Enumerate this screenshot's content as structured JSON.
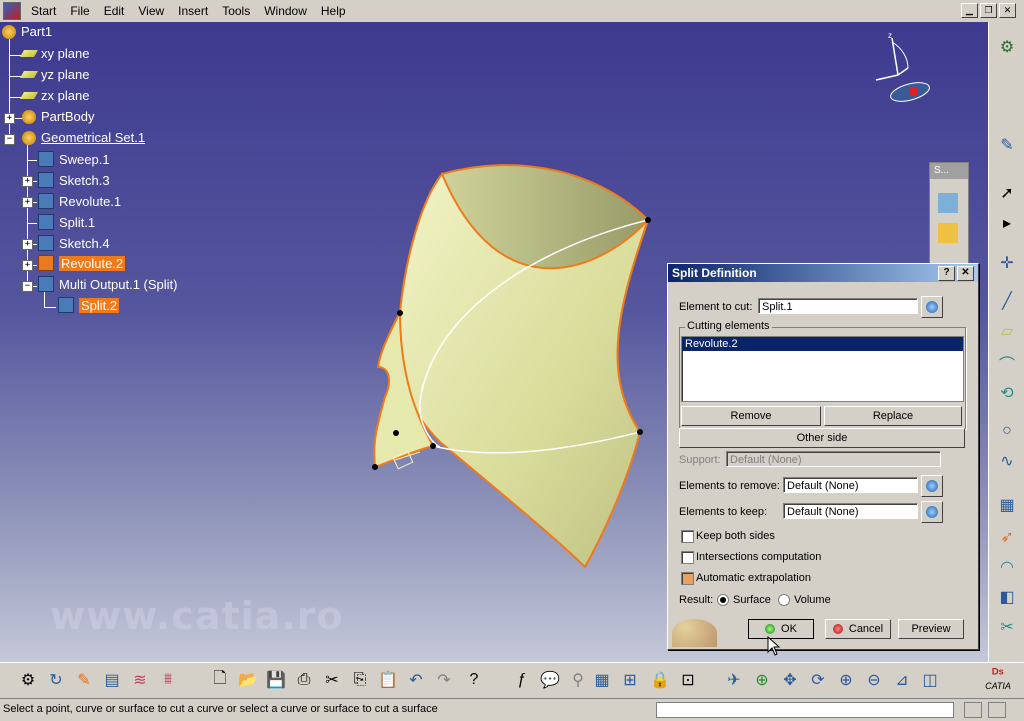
{
  "menu": {
    "items": [
      "Start",
      "File",
      "Edit",
      "View",
      "Insert",
      "Tools",
      "Window",
      "Help"
    ]
  },
  "tree": {
    "nodes": [
      {
        "label": "Part1"
      },
      {
        "label": "xy plane"
      },
      {
        "label": "yz plane"
      },
      {
        "label": "zx plane"
      },
      {
        "label": "PartBody"
      },
      {
        "label": "Geometrical Set.1"
      },
      {
        "label": "Sweep.1"
      },
      {
        "label": "Sketch.3"
      },
      {
        "label": "Revolute.1"
      },
      {
        "label": "Split.1"
      },
      {
        "label": "Sketch.4"
      },
      {
        "label": "Revolute.2"
      },
      {
        "label": "Multi Output.1 (Split)"
      },
      {
        "label": "Split.2"
      }
    ]
  },
  "watermark": "www.catia.ro",
  "float_toolbar": {
    "title": "S..."
  },
  "dialog": {
    "title": "Split Definition",
    "help_btn": "?",
    "close_btn": "✕",
    "element_to_cut_label": "Element to cut:",
    "element_to_cut_value": "Split.1",
    "cutting_elements_label": "Cutting elements",
    "cutting_elements": [
      "Revolute.2"
    ],
    "remove_btn": "Remove",
    "replace_btn": "Replace",
    "other_side_btn": "Other side",
    "support_label": "Support:",
    "support_value": "Default (None)",
    "elements_to_remove_label": "Elements to remove:",
    "elements_to_remove_value": "Default (None)",
    "elements_to_keep_label": "Elements to keep:",
    "elements_to_keep_value": "Default (None)",
    "keep_both_sides": "Keep both sides",
    "intersections_computation": "Intersections computation",
    "automatic_extrapolation": "Automatic extrapolation",
    "result_label": "Result:",
    "result_surface": "Surface",
    "result_volume": "Volume",
    "ok_btn": "OK",
    "cancel_btn": "Cancel",
    "preview_btn": "Preview"
  },
  "status": {
    "message": "Select a point, curve or surface to cut a curve or select a curve or surface to cut a surface"
  },
  "brand": {
    "logo_text": "CATIA"
  },
  "colors": {
    "selection": "#f07a1a",
    "surface": "#e2e6a8",
    "edge": "#f07a1a"
  }
}
